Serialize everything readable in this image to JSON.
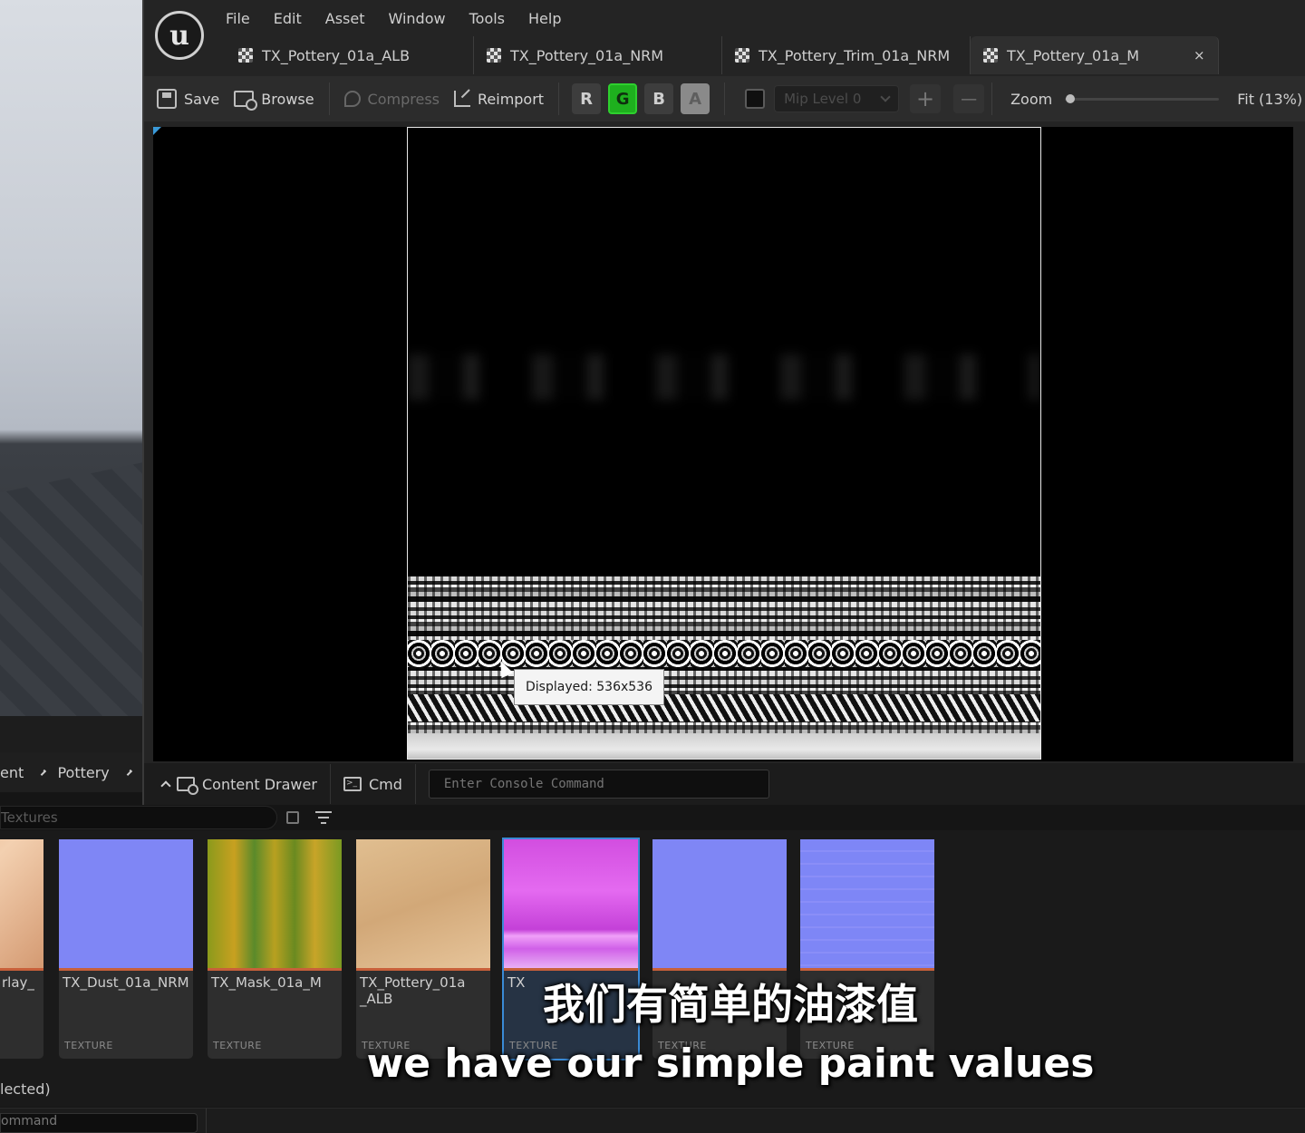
{
  "menu": [
    "File",
    "Edit",
    "Asset",
    "Window",
    "Tools",
    "Help"
  ],
  "tabs": [
    {
      "label": "TX_Pottery_01a_ALB",
      "active": false
    },
    {
      "label": "TX_Pottery_01a_NRM",
      "active": false
    },
    {
      "label": "TX_Pottery_Trim_01a_NRM",
      "active": false
    },
    {
      "label": "TX_Pottery_01a_M",
      "active": true
    }
  ],
  "tab_close_glyph": "×",
  "toolbar": {
    "save": "Save",
    "browse": "Browse",
    "compress": "Compress",
    "reimport": "Reimport",
    "channels": [
      {
        "label": "R",
        "state": "off"
      },
      {
        "label": "G",
        "state": "on"
      },
      {
        "label": "B",
        "state": "off"
      },
      {
        "label": "A",
        "state": "alpha"
      }
    ],
    "mip_level": "Mip Level 0",
    "plus": "+",
    "minus": "—",
    "zoom_label": "Zoom",
    "zoom_value": 0.13,
    "fit_label": "Fit (13%)"
  },
  "viewport": {
    "tooltip": "Displayed: 536x536"
  },
  "editor_bottom": {
    "content_drawer": "Content Drawer",
    "cmd": "Cmd",
    "console_placeholder": "Enter Console Command"
  },
  "breadcrumb": [
    "ent",
    "Pottery"
  ],
  "search": {
    "placeholder": "Textures"
  },
  "assets": [
    {
      "name": "rlay_",
      "type": "",
      "thumb": "linear-gradient(135deg,#e6b48a,#f3d0b0 40%,#d49a72)"
    },
    {
      "name": "TX_Dust_01a_NRM",
      "type": "TEXTURE",
      "thumb": "#7f86f5"
    },
    {
      "name": "TX_Mask_01a_M",
      "type": "TEXTURE",
      "thumb": "linear-gradient(90deg,#8a9a1c,#c8a020 20%,#5a8a2a 35%,#b8a020 50%,#6a8a20 65%,#c8a428 80%,#7a9a22)"
    },
    {
      "name": "TX_Pottery_01a_ALB",
      "type": "TEXTURE",
      "thumb": "linear-gradient(160deg,#e0be90,#d2a878 50%,#e6c49a)"
    },
    {
      "name": "TX",
      "type": "TEXTURE",
      "thumb": "linear-gradient(180deg,#d24ee0,#e46af0 40%,#c440d8 70%,#f0a0f8 75%,#d060e8 85%,#e8b0f4)",
      "selected": true
    },
    {
      "name": "",
      "type": "TEXTURE",
      "thumb": "#7f86f5"
    },
    {
      "name": "",
      "type": "TEXTURE",
      "thumb": "repeating-linear-gradient(180deg,#7e86f6 0 12px,#8a8ef8 12px 14px)"
    }
  ],
  "status": "lected)",
  "console_strip": "ommand",
  "subtitles": {
    "cn": "我们有简单的油漆值",
    "en": "we have our simple paint values"
  }
}
